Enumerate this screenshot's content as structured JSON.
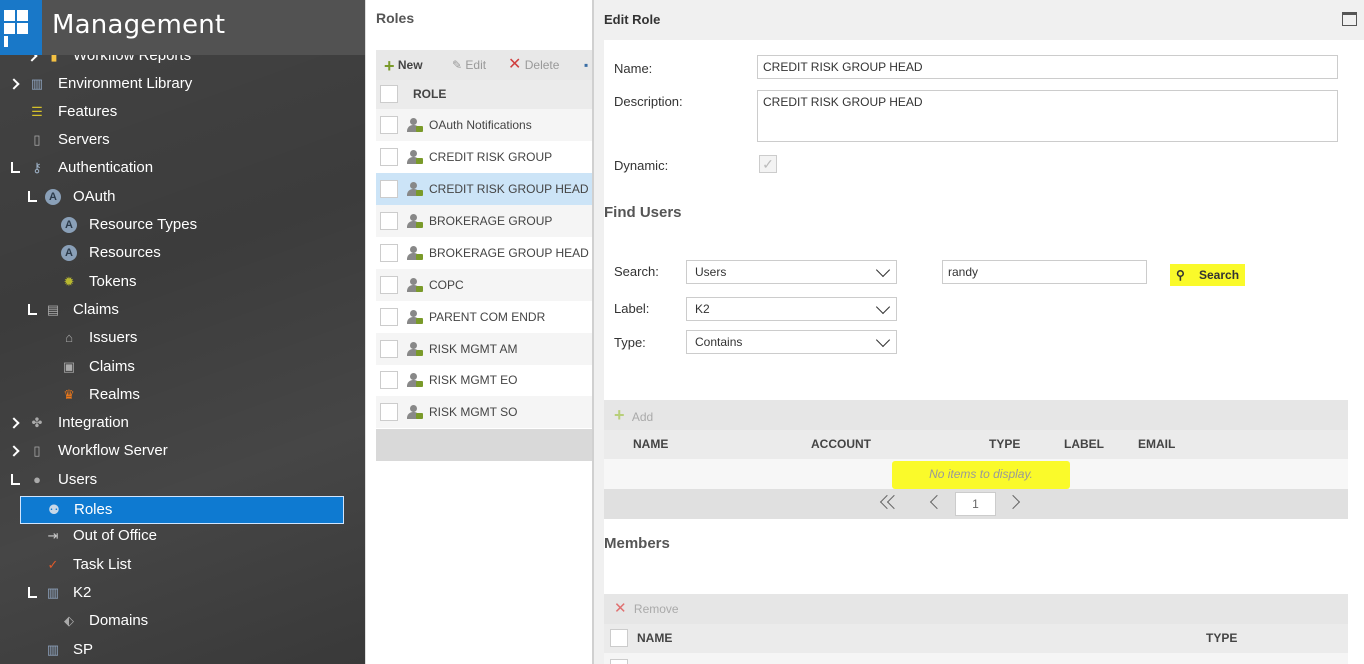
{
  "app": {
    "title": "Management"
  },
  "sidebar": {
    "items": [
      {
        "label": "Workflow Reports"
      },
      {
        "label": "Environment Library"
      },
      {
        "label": "Features"
      },
      {
        "label": "Servers"
      },
      {
        "label": "Authentication"
      },
      {
        "label": "OAuth"
      },
      {
        "label": "Resource Types"
      },
      {
        "label": "Resources"
      },
      {
        "label": "Tokens"
      },
      {
        "label": "Claims"
      },
      {
        "label": "Issuers"
      },
      {
        "label": "Claims"
      },
      {
        "label": "Realms"
      },
      {
        "label": "Integration"
      },
      {
        "label": "Workflow Server"
      },
      {
        "label": "Users"
      },
      {
        "label": "Roles"
      },
      {
        "label": "Out of Office"
      },
      {
        "label": "Task List"
      },
      {
        "label": "K2"
      },
      {
        "label": "Domains"
      },
      {
        "label": "SP"
      }
    ]
  },
  "roles": {
    "title": "Roles",
    "toolbar": {
      "new": "New",
      "edit": "Edit",
      "delete": "Delete"
    },
    "column": "ROLE",
    "rows": [
      {
        "label": "OAuth Notifications"
      },
      {
        "label": "CREDIT RISK GROUP"
      },
      {
        "label": "CREDIT RISK GROUP HEAD"
      },
      {
        "label": "BROKERAGE GROUP"
      },
      {
        "label": "BROKERAGE GROUP HEAD"
      },
      {
        "label": "COPC"
      },
      {
        "label": "PARENT COM ENDR"
      },
      {
        "label": "RISK MGMT AM"
      },
      {
        "label": "RISK MGMT EO"
      },
      {
        "label": "RISK MGMT SO"
      }
    ]
  },
  "edit": {
    "title": "Edit Role",
    "name_label": "Name:",
    "name_value": "CREDIT RISK GROUP HEAD",
    "desc_label": "Description:",
    "desc_value": "CREDIT RISK GROUP HEAD",
    "dynamic_label": "Dynamic:",
    "find_users": "Find Users",
    "search_label": "Search:",
    "search_select": "Users",
    "search_value": "randy",
    "search_button": "Search",
    "label_label": "Label:",
    "label_select": "K2",
    "type_label": "Type:",
    "type_select": "Contains",
    "grid": {
      "add": "Add",
      "columns": [
        "NAME",
        "ACCOUNT",
        "TYPE",
        "LABEL",
        "EMAIL"
      ],
      "empty": "No items to display.",
      "page": "1"
    },
    "members": {
      "title": "Members",
      "remove": "Remove",
      "columns": [
        "NAME",
        "TYPE"
      ]
    }
  },
  "colors": {
    "accent": "#0e7ad1",
    "highlight": "#fafa2a",
    "sidebar": "#3c3c3c"
  }
}
